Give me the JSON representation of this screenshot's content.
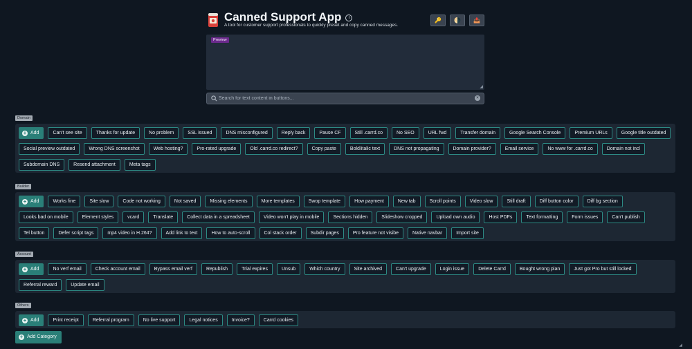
{
  "header": {
    "title": "Canned Support App",
    "info_glyph": "i",
    "subtitle": "A tool for customer support professionals to quickly preset and copy canned messages.",
    "logo_icon": "canned-tin-icon"
  },
  "toolbar": [
    {
      "name": "key-icon",
      "glyph": "🔑"
    },
    {
      "name": "theme-toggle-icon",
      "glyph": "🌗"
    },
    {
      "name": "import-icon",
      "glyph": "📤"
    }
  ],
  "preview": {
    "label": "Preview",
    "value": ""
  },
  "search": {
    "placeholder": "Search for text content in buttons...",
    "value": "",
    "clear_glyph": "×"
  },
  "add_label": "Add",
  "categories": [
    {
      "name": "Domain",
      "buttons": [
        "Can't see site",
        "Thanks for update",
        "No problem",
        "SSL issued",
        "DNS misconfigured",
        "Reply back",
        "Pause CF",
        "Still .carrd.co",
        "No SEO",
        "URL fwd",
        "Transfer domain",
        "Google Search Console",
        "Premium URLs",
        "Google title outdated",
        "Social preview outdated",
        "Wrong DNS screenshot",
        "Web hosting?",
        "Pro-rated upgrade",
        "Old .carrd.co redirect?",
        "Copy paste",
        "Bold/italic text",
        "DNS not propagating",
        "Domain provider?",
        "Email service",
        "No www for .carrd.co",
        "Domain not incl",
        "Subdomain DNS",
        "Resend attachment",
        "Meta tags"
      ]
    },
    {
      "name": "Builder",
      "buttons": [
        "Works fine",
        "Site slow",
        "Code not working",
        "Not saved",
        "Missing elements",
        "More templates",
        "Swop template",
        "How payment",
        "New tab",
        "Scroll points",
        "Video slow",
        "Still draft",
        "Diff button color",
        "Diff bg section",
        "Looks bad on mobile",
        "Element styles",
        "vcard",
        "Translate",
        "Collect data in a spreadsheet",
        "Video won't play in mobile",
        "Sections hidden",
        "Slideshow cropped",
        "Upload own audio",
        "Host PDFs",
        "Text formatting",
        "Form issues",
        "Can't publish",
        "Tel button",
        "Defer script tags",
        "mp4 video in H.264?",
        "Add link to text",
        "How to auto-scroll",
        "Col stack order",
        "Subdir pages",
        "Pro feature not visibe",
        "Native navbar",
        "Import site"
      ]
    },
    {
      "name": "Account",
      "buttons": [
        "No verf email",
        "Check account email",
        "Bypass email verf",
        "Republish",
        "Trial expires",
        "Unsub",
        "Which country",
        "Site archived",
        "Can't upgrade",
        "Login issue",
        "Delete Carrd",
        "Bought wrong plan",
        "Just got Pro but still locked",
        "Referral reward",
        "Update email"
      ]
    },
    {
      "name": "Others",
      "buttons": [
        "Print receipt",
        "Referral program",
        "No live support",
        "Legal notices",
        "Invoice?",
        "Carrd cookies"
      ]
    }
  ],
  "add_category_label": "Add Category",
  "colors": {
    "background": "#0f1721",
    "panel": "#1d2733",
    "accent": "#2a7f78",
    "chip_border": "#2d8a84",
    "preview_badge": "#6b2a8c"
  }
}
